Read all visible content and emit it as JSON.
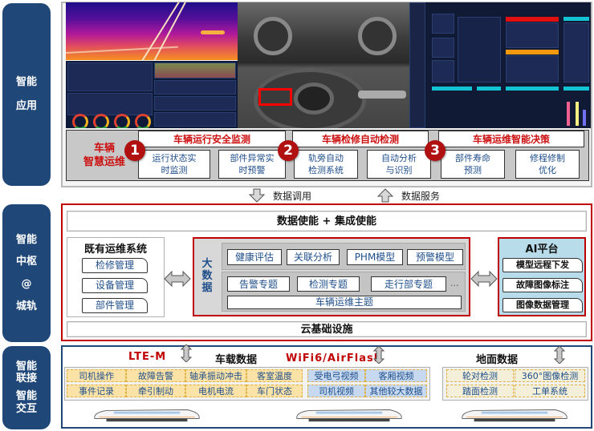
{
  "side_labels": {
    "app": [
      "智能",
      "应用"
    ],
    "hub": [
      "智能",
      "中枢",
      "@",
      "城轨"
    ],
    "connect": [
      "智能",
      "联接",
      "智能",
      "交互"
    ]
  },
  "smart_ops": {
    "title_line1": "车辆",
    "title_line2": "智慧运维",
    "categories": [
      {
        "number": "1",
        "title": "车辆运行安全监测",
        "functions": [
          {
            "line1": "运行状态实",
            "line2": "时监测"
          },
          {
            "line1": "部件异常实",
            "line2": "时预警"
          }
        ]
      },
      {
        "number": "2",
        "title": "车辆检修自动检测",
        "functions": [
          {
            "line1": "轨旁自动",
            "line2": "检测系统"
          },
          {
            "line1": "自动分析",
            "line2": "与识别"
          }
        ]
      },
      {
        "number": "3",
        "title": "车辆运维智能决策",
        "functions": [
          {
            "line1": "部件寿命",
            "line2": "预测"
          },
          {
            "line1": "修程修制",
            "line2": "优化"
          }
        ]
      }
    ]
  },
  "data_flow": {
    "down_label": "数据调用",
    "up_label": "数据服务"
  },
  "hub": {
    "top_bar": "数据使能 + 集成使能",
    "bottom_bar": "云基础设施",
    "legacy": {
      "title": "既有运维系统",
      "items": [
        "检修管理",
        "设备管理",
        "部件管理"
      ]
    },
    "bigdata": {
      "label_chars": [
        "大",
        "数",
        "据"
      ],
      "models": [
        "健康评估",
        "关联分析",
        "PHM模型",
        "预警模型"
      ],
      "topics": [
        "告警专题",
        "检测专题",
        "走行部专题"
      ],
      "more": "...",
      "main_topic": "车辆运维主题"
    },
    "ai": {
      "title": "AI平台",
      "items": [
        "模型远程下发",
        "故障图像标注",
        "图像数据管理"
      ]
    }
  },
  "connect": {
    "lte": "LTE-M",
    "wifi": "WiFi6/AirFlash",
    "onboard_title": "车载数据",
    "ground_title": "地面数据",
    "onboard_yellow": [
      [
        "司机操作",
        "故障告警",
        "轴承振动冲击",
        "客室温度"
      ],
      [
        "事件记录",
        "牵引制动",
        "电机电流",
        "车门状态"
      ]
    ],
    "onboard_blue": [
      [
        "受电弓视频",
        "客厢视频"
      ],
      [
        "司机视频",
        "其他较大数据"
      ]
    ],
    "ground": [
      [
        "轮对检测",
        "360°图像检测"
      ],
      [
        "踏面检测",
        "工单系统"
      ]
    ]
  },
  "colors": {
    "navy": "#1f4778",
    "red": "#c00000",
    "text_blue": "#1f4e8a",
    "yellow_cell": "#fbe3a8",
    "blue_cell": "#c6d9f0",
    "ai_bg": "#b8dcea"
  }
}
